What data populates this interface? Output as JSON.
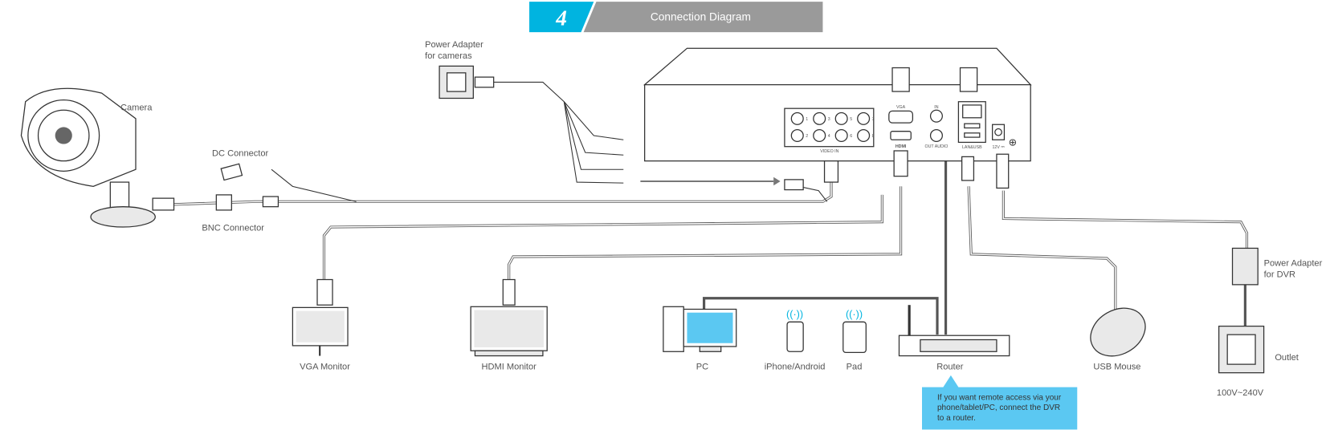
{
  "header": {
    "step_number": "4",
    "title": "Connection Diagram",
    "colors": {
      "accent": "#00b4e0",
      "bar": "#9a9a9a"
    }
  },
  "labels": {
    "camera": "Camera",
    "dc_connector": "DC Connector",
    "bnc_connector": "BNC Connector",
    "power_adapter_cameras": [
      "Power Adapter",
      "for cameras"
    ],
    "vga_monitor": "VGA Monitor",
    "hdmi_monitor": "HDMI Monitor",
    "pc": "PC",
    "phone": "iPhone/Android",
    "pad": "Pad",
    "router": "Router",
    "usb_mouse": "USB Mouse",
    "power_adapter_dvr": [
      "Power Adapter",
      "for DVR"
    ],
    "outlet": "Outlet",
    "voltage": "100V~240V"
  },
  "dvr_panel": {
    "video_in": "VIDEO IN",
    "channels": [
      "1",
      "2",
      "3",
      "4",
      "5",
      "6",
      "7",
      "8"
    ],
    "vga": "VGA",
    "hdmi": "HDMI",
    "audio_in": "IN",
    "audio_out": "OUT AUDIO",
    "lan_usb": "LAN&USB",
    "power": "12V ⎓"
  },
  "callout": {
    "lines": [
      "If you want remote access via your",
      "phone/tablet/PC, connect the DVR",
      "to a router."
    ],
    "color": "#5bc8f2"
  }
}
